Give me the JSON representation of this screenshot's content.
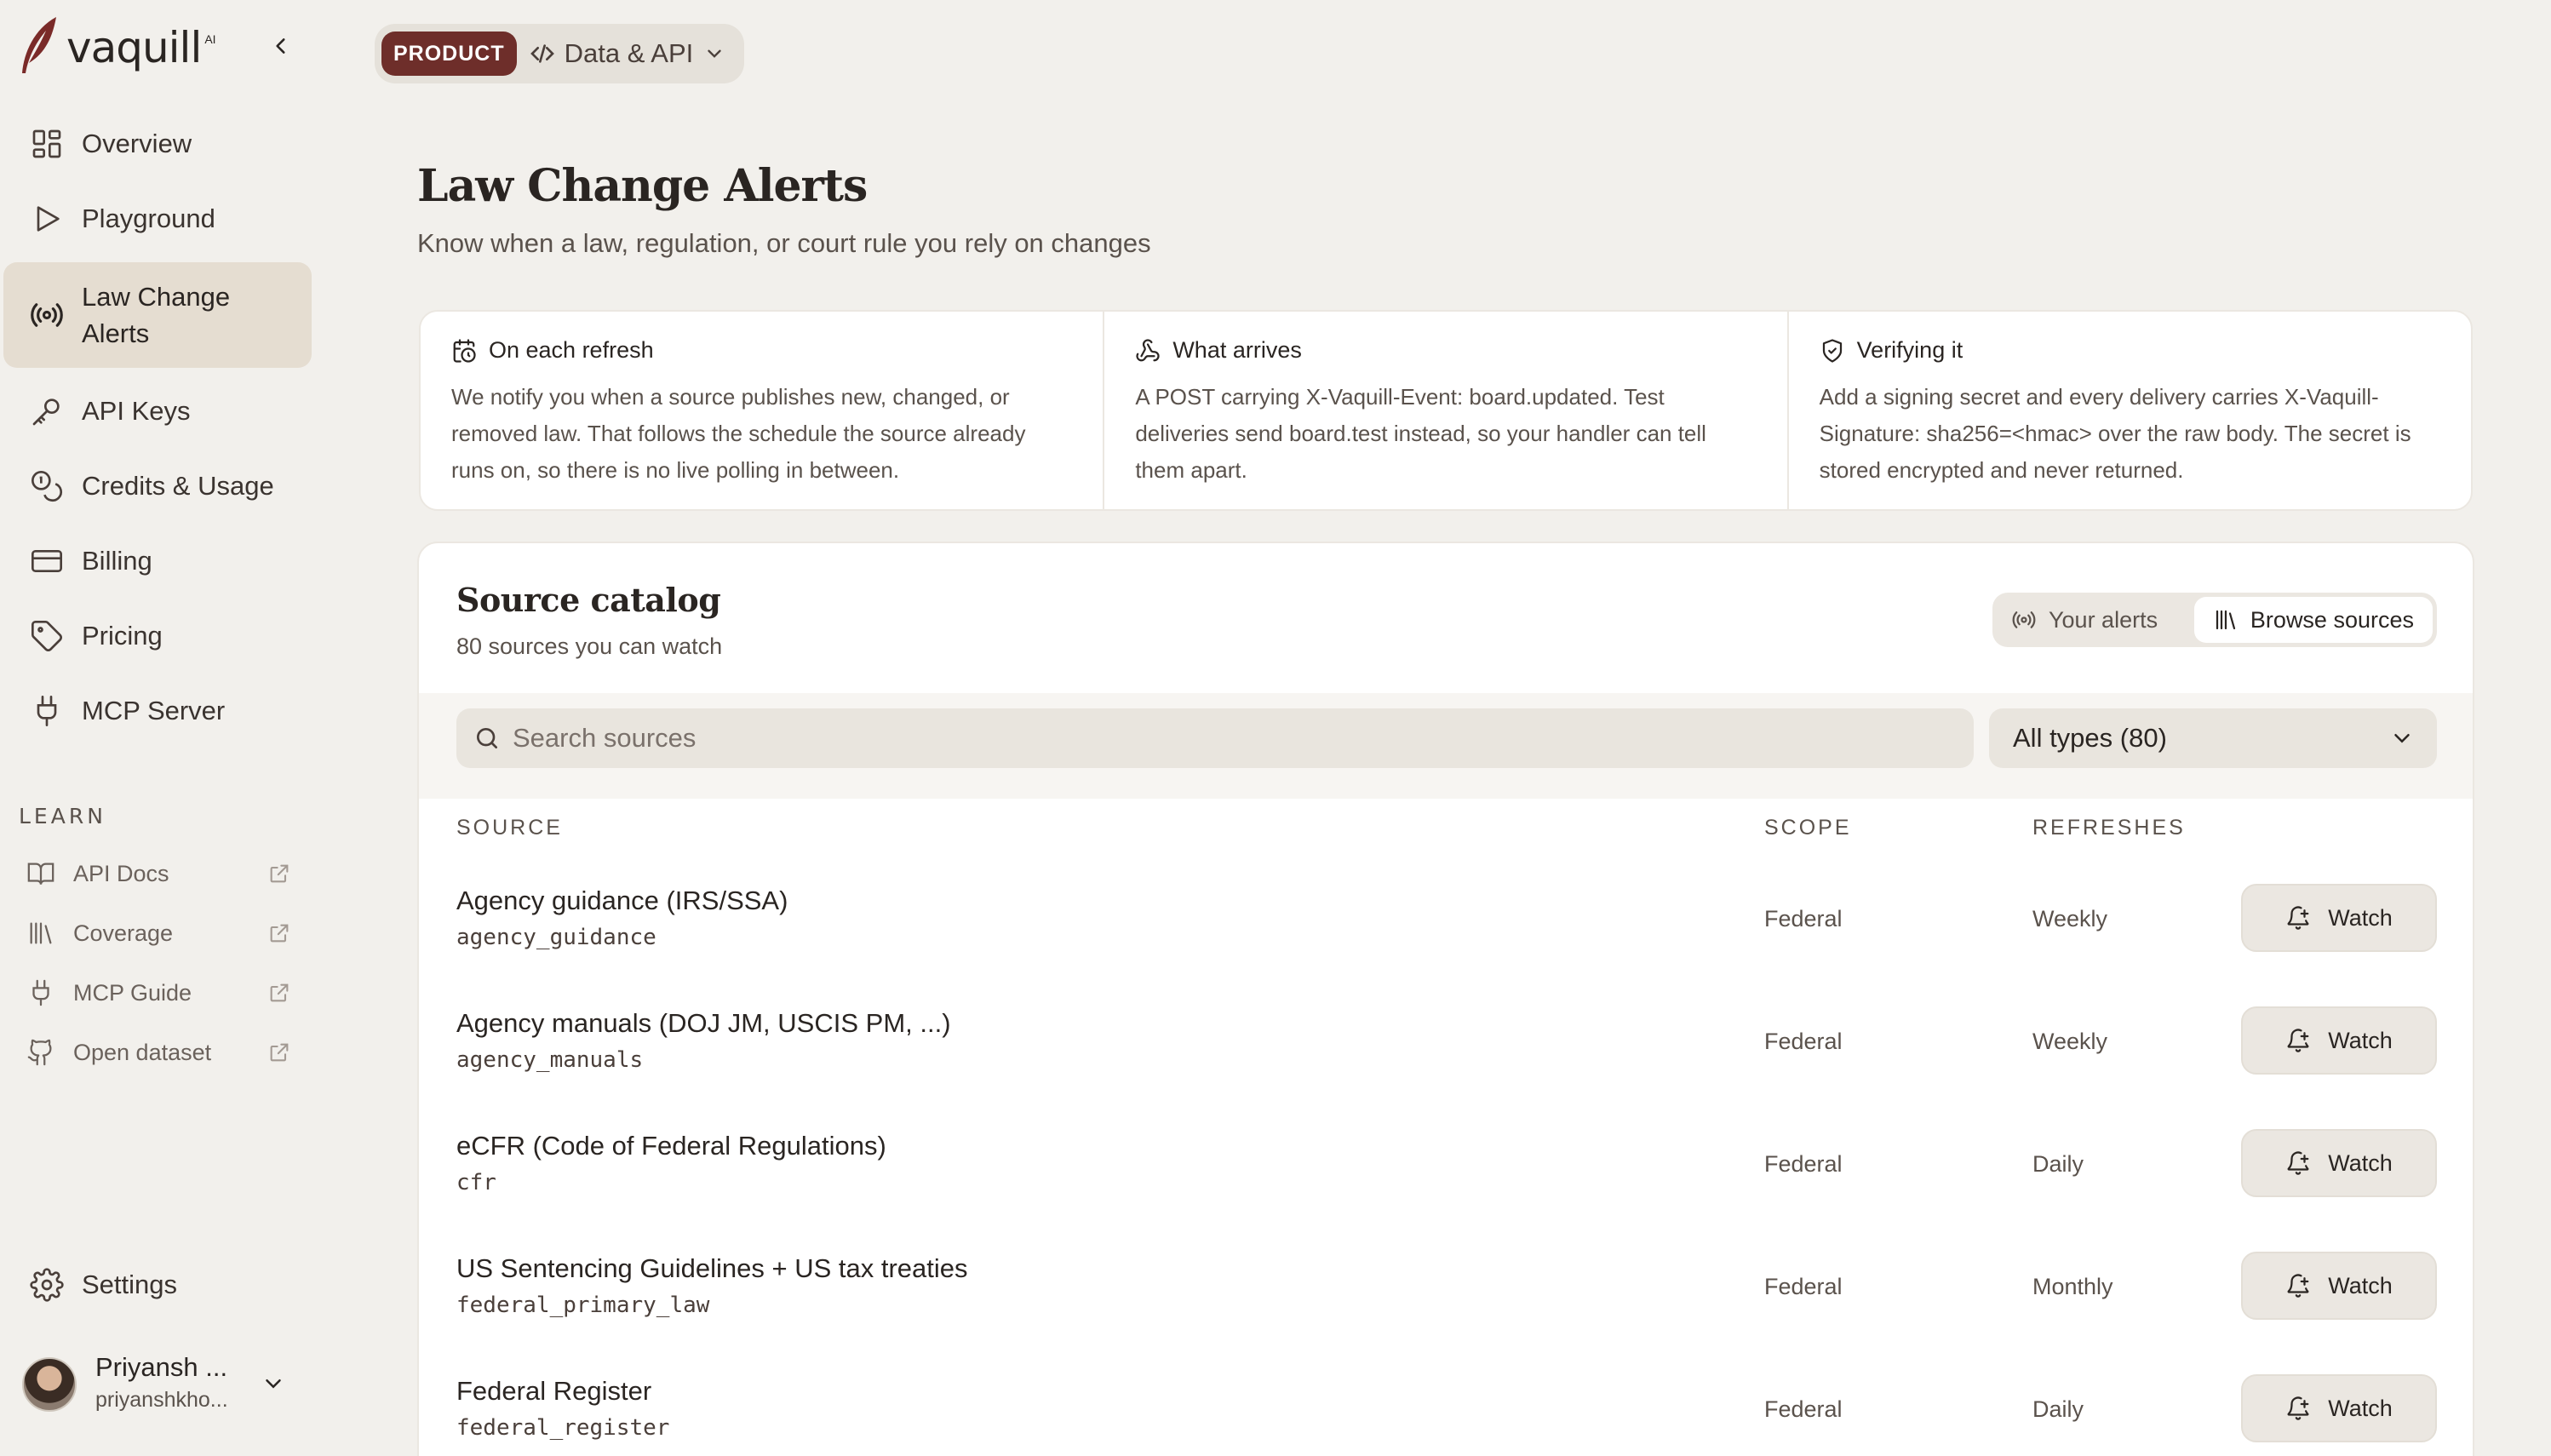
{
  "brand": {
    "name": "vaquill",
    "sup": "AI"
  },
  "sidebar": {
    "items": [
      {
        "label": "Overview",
        "icon": "layout-grid-icon"
      },
      {
        "label": "Playground",
        "icon": "play-icon"
      },
      {
        "label": "Law Change Alerts",
        "icon": "broadcast-icon",
        "active": true
      },
      {
        "label": "API Keys",
        "icon": "key-icon"
      },
      {
        "label": "Credits & Usage",
        "icon": "coins-icon"
      },
      {
        "label": "Billing",
        "icon": "credit-card-icon"
      },
      {
        "label": "Pricing",
        "icon": "tag-icon"
      },
      {
        "label": "MCP Server",
        "icon": "plug-icon"
      }
    ],
    "learn_heading": "LEARN",
    "learn_items": [
      {
        "label": "API Docs",
        "icon": "book-open-icon"
      },
      {
        "label": "Coverage",
        "icon": "library-icon"
      },
      {
        "label": "MCP Guide",
        "icon": "plug-icon"
      },
      {
        "label": "Open dataset",
        "icon": "github-icon"
      }
    ],
    "settings_label": "Settings",
    "user": {
      "name": "Priyansh ...",
      "email": "priyanshkho..."
    }
  },
  "breadcrumb": {
    "badge": "PRODUCT",
    "label": "Data & API"
  },
  "page": {
    "title": "Law Change Alerts",
    "subtitle": "Know when a law, regulation, or court rule you rely on changes"
  },
  "info_cards": [
    {
      "title": "On each refresh",
      "icon": "calendar-clock-icon",
      "body": "We notify you when a source publishes new, changed, or removed law. That follows the schedule the source already runs on, so there is no live polling in between."
    },
    {
      "title": "What arrives",
      "icon": "webhook-icon",
      "body": "A POST carrying X-Vaquill-Event: board.updated. Test deliveries send board.test instead, so your handler can tell them apart."
    },
    {
      "title": "Verifying it",
      "icon": "shield-check-icon",
      "body": "Add a signing secret and every delivery carries X-Vaquill-Signature: sha256=<hmac> over the raw body. The secret is stored encrypted and never returned."
    }
  ],
  "catalog": {
    "title": "Source catalog",
    "subtitle": "80 sources you can watch",
    "toggle": {
      "your_alerts": "Your alerts",
      "browse_sources": "Browse sources",
      "selected": "browse_sources"
    },
    "search_placeholder": "Search sources",
    "type_filter": "All types (80)",
    "columns": {
      "source": "SOURCE",
      "scope": "SCOPE",
      "refreshes": "REFRESHES"
    },
    "watch_label": "Watch",
    "rows": [
      {
        "name": "Agency guidance (IRS/SSA)",
        "id": "agency_guidance",
        "scope": "Federal",
        "refreshes": "Weekly"
      },
      {
        "name": "Agency manuals (DOJ JM, USCIS PM, ...)",
        "id": "agency_manuals",
        "scope": "Federal",
        "refreshes": "Weekly"
      },
      {
        "name": "eCFR (Code of Federal Regulations)",
        "id": "cfr",
        "scope": "Federal",
        "refreshes": "Daily"
      },
      {
        "name": "US Sentencing Guidelines + US tax treaties",
        "id": "federal_primary_law",
        "scope": "Federal",
        "refreshes": "Monthly"
      },
      {
        "name": "Federal Register",
        "id": "federal_register",
        "scope": "Federal",
        "refreshes": "Daily"
      }
    ]
  },
  "colors": {
    "accent": "#6e2e2a",
    "background": "#f2f0ec",
    "active_nav": "#e5ddd1"
  }
}
